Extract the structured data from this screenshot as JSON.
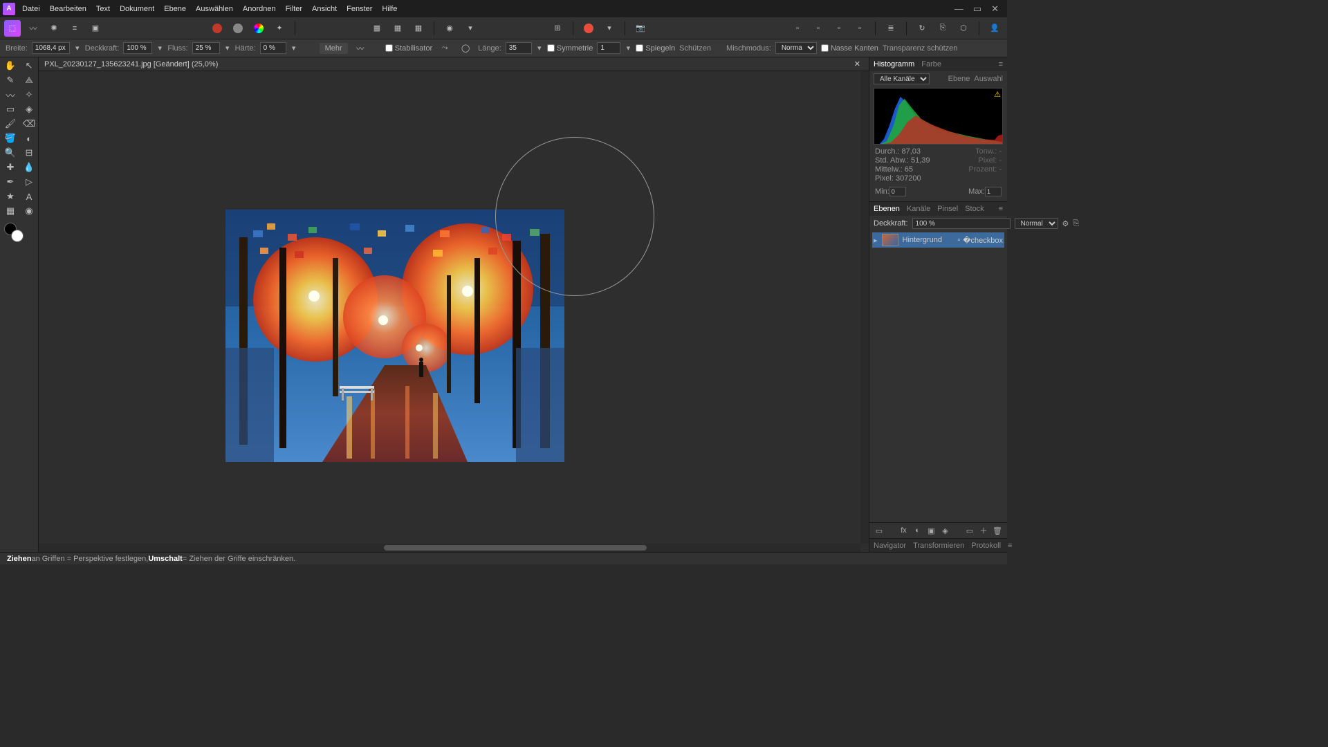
{
  "menubar": [
    "Datei",
    "Bearbeiten",
    "Text",
    "Dokument",
    "Ebene",
    "Auswählen",
    "Anordnen",
    "Filter",
    "Ansicht",
    "Fenster",
    "Hilfe"
  ],
  "context": {
    "breite_label": "Breite:",
    "breite": "1068,4 px",
    "deckkraft_label": "Deckkraft:",
    "deckkraft": "100 %",
    "fluss_label": "Fluss:",
    "fluss": "25 %",
    "haerte_label": "Härte:",
    "haerte": "0 %",
    "mehr": "Mehr",
    "stabilisator": "Stabilisator",
    "laenge_label": "Länge:",
    "laenge": "35",
    "symmetrie": "Symmetrie",
    "symmetrie_val": "1",
    "spiegeln": "Spiegeln",
    "schuetzen": "Schützen",
    "mischmodus_label": "Mischmodus:",
    "mischmodus": "Normal",
    "nasse": "Nasse Kanten",
    "transparenz": "Transparenz schützen"
  },
  "document_tab": "PXL_20230127_135623241.jpg [Geändert] (25,0%)",
  "histogram": {
    "tab1": "Histogramm",
    "tab2": "Farbe",
    "channels": "Alle Kanäle",
    "ebene": "Ebene",
    "auswahl": "Auswahl",
    "durch": "Durch.: 87,03",
    "stdabw": "Std. Abw.: 51,39",
    "mittelw": "Mittelw.: 65",
    "pixel": "Pixel: 307200",
    "tonw": "Tonw.: -",
    "pixel2": "Pixel: -",
    "prozent": "Prozent: -",
    "min_label": "Min:",
    "min": "0",
    "max_label": "Max:",
    "max": "1"
  },
  "layers": {
    "tabs": [
      "Ebenen",
      "Kanäle",
      "Pinsel",
      "Stock"
    ],
    "deckkraft_label": "Deckkraft:",
    "deckkraft": "100 %",
    "blend": "Normal",
    "layer_name": "Hintergrund"
  },
  "bottom_tabs": [
    "Navigator",
    "Transformieren",
    "Protokoll"
  ],
  "status": {
    "pre": "Ziehen ",
    "t1": "an Griffen = Perspektive festlegen, ",
    "b2": "Umschalt",
    "t2": " = Ziehen der Griffe einschränken."
  }
}
